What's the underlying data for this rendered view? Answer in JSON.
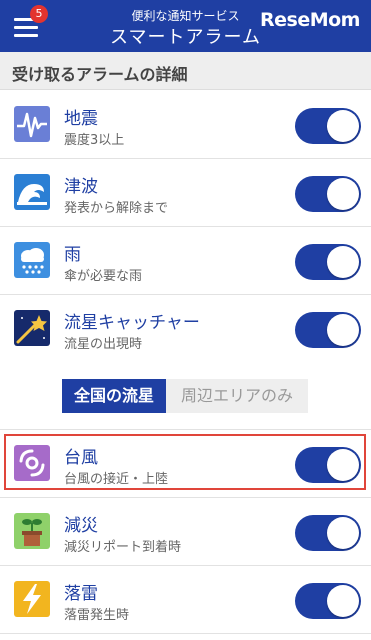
{
  "header": {
    "subtitle": "便利な通知サービス",
    "title": "スマートアラーム",
    "badge_count": "5",
    "logo_text": "ReseMom"
  },
  "section": {
    "title": "受け取るアラームの詳細"
  },
  "alarms": [
    {
      "title": "地震",
      "desc": "震度3以上",
      "icon": "seismograph-icon",
      "enabled": true
    },
    {
      "title": "津波",
      "desc": "発表から解除まで",
      "icon": "wave-icon",
      "enabled": true
    },
    {
      "title": "雨",
      "desc": "傘が必要な雨",
      "icon": "rain-cloud-icon",
      "enabled": true
    },
    {
      "title": "流星キャッチャー",
      "desc": "流星の出現時",
      "icon": "shooting-star-icon",
      "enabled": true
    },
    {
      "title": "台風",
      "desc": "台風の接近・上陸",
      "icon": "typhoon-icon",
      "enabled": true
    },
    {
      "title": "減災",
      "desc": "減災リポート到着時",
      "icon": "seedling-icon",
      "enabled": true
    },
    {
      "title": "落雷",
      "desc": "落雷発生時",
      "icon": "lightning-icon",
      "enabled": true
    }
  ],
  "meteor_scope": {
    "options": [
      "全国の流星",
      "周辺エリアのみ"
    ],
    "selected": "全国の流星"
  },
  "colors": {
    "primary": "#1f3fa3",
    "badge": "#e3342f",
    "highlight": "#e0453a"
  }
}
